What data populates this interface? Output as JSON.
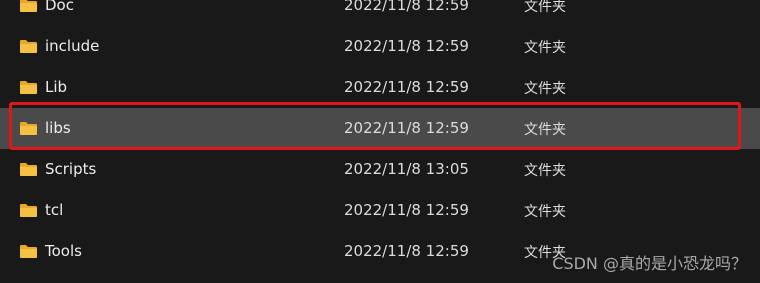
{
  "files": [
    {
      "name": "Doc",
      "modified": "2022/11/8 12:59",
      "type": "文件夹",
      "icon": "folder-icon"
    },
    {
      "name": "include",
      "modified": "2022/11/8 12:59",
      "type": "文件夹",
      "icon": "folder-icon"
    },
    {
      "name": "Lib",
      "modified": "2022/11/8 12:59",
      "type": "文件夹",
      "icon": "folder-icon"
    },
    {
      "name": "libs",
      "modified": "2022/11/8 12:59",
      "type": "文件夹",
      "icon": "folder-icon",
      "selected": true
    },
    {
      "name": "Scripts",
      "modified": "2022/11/8 13:05",
      "type": "文件夹",
      "icon": "folder-icon"
    },
    {
      "name": "tcl",
      "modified": "2022/11/8 12:59",
      "type": "文件夹",
      "icon": "folder-icon"
    },
    {
      "name": "Tools",
      "modified": "2022/11/8 12:59",
      "type": "文件夹",
      "icon": "folder-icon"
    }
  ],
  "watermark": "CSDN @真的是小恐龙吗？",
  "colors": {
    "background": "#191919",
    "selected_row": "#4a4a4a",
    "highlight_outline": "#e0161b",
    "folder": "#f5c144"
  }
}
